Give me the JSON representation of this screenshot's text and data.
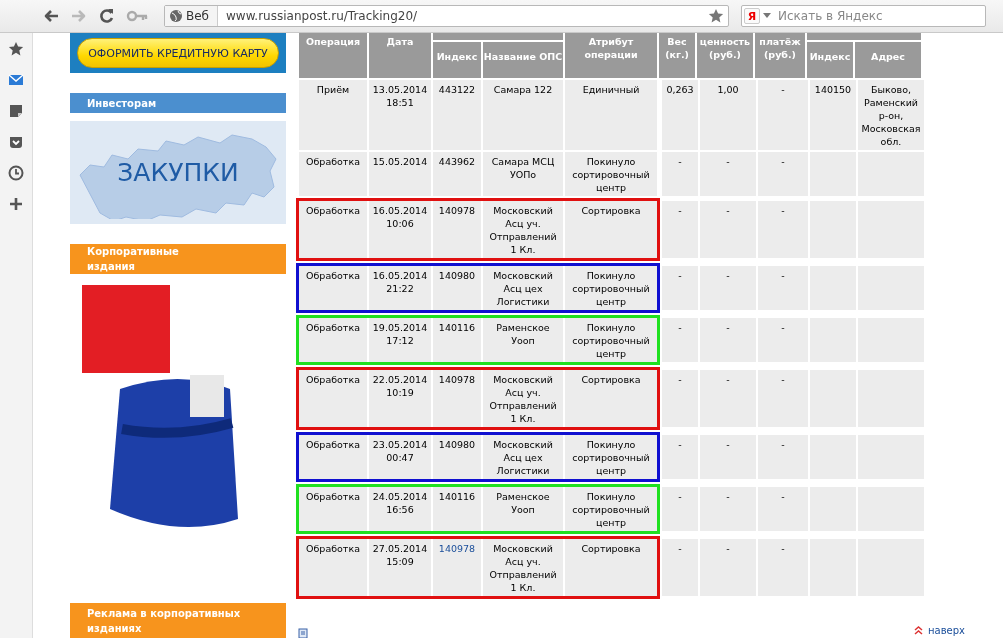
{
  "browser": {
    "back": {
      "disabled": false
    },
    "forward": {
      "disabled": true
    },
    "site_button": "Веб",
    "url": "www.russianpost.ru/Tracking20/",
    "search": {
      "logo": "Я",
      "placeholder": "Искать в Яндекс"
    }
  },
  "left_column": {
    "credit_card_button": "ОФОРМИТЬ КРЕДИТНУЮ КАРТУ",
    "investors_heading": "Инвесторам",
    "procurement_banner": "ЗАКУПКИ",
    "corporate_heading": "Корпоративные издания",
    "advertising_heading": "Реклама в корпоративных изданиях"
  },
  "table": {
    "columns": [
      {
        "label": "Операция",
        "grouped": false
      },
      {
        "label": "Дата",
        "grouped": false
      },
      {
        "label": "Индекс",
        "grouped": true
      },
      {
        "label": "Название ОПС",
        "grouped": true
      },
      {
        "label": "Атрибут операции",
        "grouped": false
      },
      {
        "label": "Вес (кг.)",
        "grouped": false
      },
      {
        "label": "ценность (руб.)",
        "grouped": false
      },
      {
        "label": "платёж (руб.)",
        "grouped": false
      },
      {
        "label": "Индекс",
        "grouped": true
      },
      {
        "label": "Адрес",
        "grouped": true
      }
    ],
    "rows": [
      {
        "operation": "Приём",
        "date": "13.05.2014 18:51",
        "index": "443122",
        "index_link": false,
        "office": "Самара 122",
        "attribute": "Единичный",
        "weight": "0,263",
        "value": "1,00",
        "payment": "-",
        "dest_index": "140150",
        "address": "Быково, Раменский р-он, Московская обл."
      },
      {
        "operation": "Обработка",
        "date": "15.05.2014",
        "index": "443962",
        "index_link": false,
        "office": "Самара МСЦ УОПо",
        "attribute": "Покинуло сортировочный центр",
        "weight": "-",
        "value": "-",
        "payment": "-"
      },
      {
        "operation": "Обработка",
        "date": "16.05.2014 10:06",
        "index": "140978",
        "index_link": false,
        "office": "Московский Асц уч. Отправлений 1 Кл.",
        "attribute": "Сортировка",
        "weight": "-",
        "value": "-",
        "payment": "-",
        "color": "#e01010"
      },
      {
        "operation": "Обработка",
        "date": "16.05.2014 21:22",
        "index": "140980",
        "index_link": false,
        "office": "Московский Асц цех Логистики",
        "attribute": "Покинуло сортировочный центр",
        "weight": "-",
        "value": "-",
        "payment": "-",
        "color": "#1010d0"
      },
      {
        "operation": "Обработка",
        "date": "19.05.2014 17:12",
        "index": "140116",
        "index_link": false,
        "office": "Раменское Уооп",
        "attribute": "Покинуло сортировочный центр",
        "weight": "-",
        "value": "-",
        "payment": "-",
        "color": "#20e020"
      },
      {
        "operation": "Обработка",
        "date": "22.05.2014 10:19",
        "index": "140978",
        "index_link": false,
        "office": "Московский Асц уч. Отправлений 1 Кл.",
        "attribute": "Сортировка",
        "weight": "-",
        "value": "-",
        "payment": "-",
        "color": "#e01010"
      },
      {
        "operation": "Обработка",
        "date": "23.05.2014 00:47",
        "index": "140980",
        "index_link": false,
        "office": "Московский Асц цех Логистики",
        "attribute": "Покинуло сортировочный центр",
        "weight": "-",
        "value": "-",
        "payment": "-",
        "color": "#1010d0"
      },
      {
        "operation": "Обработка",
        "date": "24.05.2014 16:56",
        "index": "140116",
        "index_link": false,
        "office": "Раменское Уооп",
        "attribute": "Покинуло сортировочный центр",
        "weight": "-",
        "value": "-",
        "payment": "-",
        "color": "#20e020"
      },
      {
        "operation": "Обработка",
        "date": "27.05.2014 15:09",
        "index": "140978",
        "index_link": true,
        "office": "Московский Асц уч. Отправлений 1 Кл.",
        "attribute": "Сортировка",
        "weight": "-",
        "value": "-",
        "payment": "-",
        "color": "#e01010"
      }
    ]
  },
  "footer": {
    "top_link": "наверх"
  }
}
